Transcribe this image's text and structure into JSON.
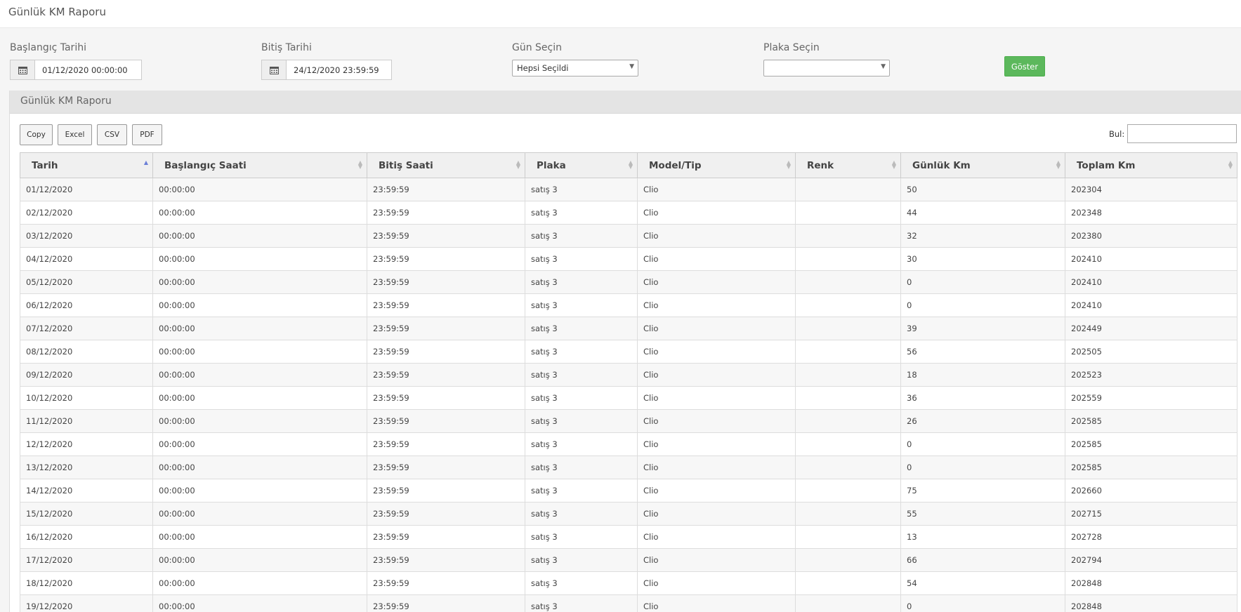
{
  "page_title": "Günlük KM Raporu",
  "filters": {
    "start_label": "Başlangıç Tarihi",
    "start_value": "01/12/2020 00:00:00",
    "end_label": "Bitiş Tarihi",
    "end_value": "24/12/2020 23:59:59",
    "day_label": "Gün Seçin",
    "day_value": "Hepsi Seçildi",
    "plate_label": "Plaka Seçin",
    "plate_value": "",
    "show_button": "Göster",
    "calendar_icon": "calendar-icon"
  },
  "panel": {
    "title": "Günlük KM Raporu",
    "buttons": [
      "Copy",
      "Excel",
      "CSV",
      "PDF"
    ],
    "search_label": "Bul:",
    "search_value": ""
  },
  "table": {
    "columns": [
      "Tarih",
      "Başlangıç Saati",
      "Bitiş Saati",
      "Plaka",
      "Model/Tip",
      "Renk",
      "Günlük Km",
      "Toplam Km"
    ],
    "sorted_column": "Tarih",
    "rows": [
      [
        "01/12/2020",
        "00:00:00",
        "23:59:59",
        "satış 3",
        "Clio",
        "",
        "50",
        "202304"
      ],
      [
        "02/12/2020",
        "00:00:00",
        "23:59:59",
        "satış 3",
        "Clio",
        "",
        "44",
        "202348"
      ],
      [
        "03/12/2020",
        "00:00:00",
        "23:59:59",
        "satış 3",
        "Clio",
        "",
        "32",
        "202380"
      ],
      [
        "04/12/2020",
        "00:00:00",
        "23:59:59",
        "satış 3",
        "Clio",
        "",
        "30",
        "202410"
      ],
      [
        "05/12/2020",
        "00:00:00",
        "23:59:59",
        "satış 3",
        "Clio",
        "",
        "0",
        "202410"
      ],
      [
        "06/12/2020",
        "00:00:00",
        "23:59:59",
        "satış 3",
        "Clio",
        "",
        "0",
        "202410"
      ],
      [
        "07/12/2020",
        "00:00:00",
        "23:59:59",
        "satış 3",
        "Clio",
        "",
        "39",
        "202449"
      ],
      [
        "08/12/2020",
        "00:00:00",
        "23:59:59",
        "satış 3",
        "Clio",
        "",
        "56",
        "202505"
      ],
      [
        "09/12/2020",
        "00:00:00",
        "23:59:59",
        "satış 3",
        "Clio",
        "",
        "18",
        "202523"
      ],
      [
        "10/12/2020",
        "00:00:00",
        "23:59:59",
        "satış 3",
        "Clio",
        "",
        "36",
        "202559"
      ],
      [
        "11/12/2020",
        "00:00:00",
        "23:59:59",
        "satış 3",
        "Clio",
        "",
        "26",
        "202585"
      ],
      [
        "12/12/2020",
        "00:00:00",
        "23:59:59",
        "satış 3",
        "Clio",
        "",
        "0",
        "202585"
      ],
      [
        "13/12/2020",
        "00:00:00",
        "23:59:59",
        "satış 3",
        "Clio",
        "",
        "0",
        "202585"
      ],
      [
        "14/12/2020",
        "00:00:00",
        "23:59:59",
        "satış 3",
        "Clio",
        "",
        "75",
        "202660"
      ],
      [
        "15/12/2020",
        "00:00:00",
        "23:59:59",
        "satış 3",
        "Clio",
        "",
        "55",
        "202715"
      ],
      [
        "16/12/2020",
        "00:00:00",
        "23:59:59",
        "satış 3",
        "Clio",
        "",
        "13",
        "202728"
      ],
      [
        "17/12/2020",
        "00:00:00",
        "23:59:59",
        "satış 3",
        "Clio",
        "",
        "66",
        "202794"
      ],
      [
        "18/12/2020",
        "00:00:00",
        "23:59:59",
        "satış 3",
        "Clio",
        "",
        "54",
        "202848"
      ],
      [
        "19/12/2020",
        "00:00:00",
        "23:59:59",
        "satış 3",
        "Clio",
        "",
        "0",
        "202848"
      ]
    ]
  },
  "colors": {
    "show_button": "#5cb85c",
    "sort_active": "#6b7fd7"
  }
}
